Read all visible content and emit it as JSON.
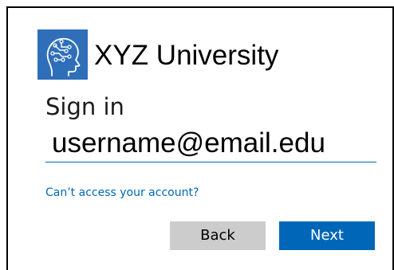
{
  "brand": {
    "name": "XYZ University",
    "logo_icon": "brain-head-icon",
    "logo_color": "#2f6fba"
  },
  "signin": {
    "title": "Sign in",
    "email_value": "username@email.edu",
    "help_link": "Can’t access your account?"
  },
  "buttons": {
    "back_label": "Back",
    "next_label": "Next",
    "primary_color": "#0067b8",
    "secondary_color": "#cccccc"
  }
}
